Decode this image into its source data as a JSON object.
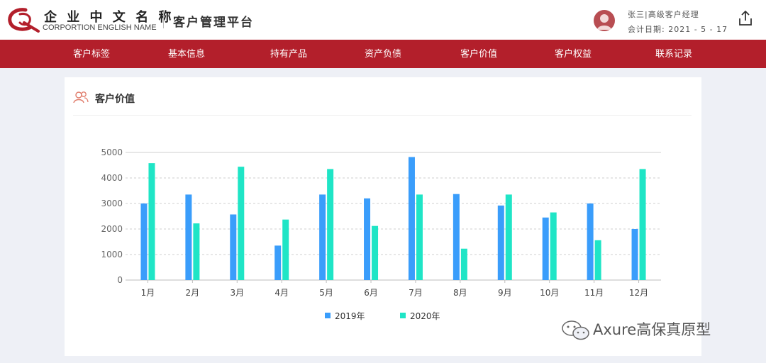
{
  "header": {
    "logo_cn": "企 业 中 文 名 称",
    "logo_en": "CORPORTION ENGLISH NAME",
    "platform_title": "客户管理平台",
    "user": "张三|高级客户经理",
    "date": "会计日期: 2021 - 5 - 17",
    "icons": {
      "avatar": "user-avatar-icon",
      "export": "export-icon"
    },
    "colors": {
      "brand_red": "#b31f2b",
      "avatar": "#b84d52"
    }
  },
  "nav": {
    "items": [
      "客户标签",
      "基本信息",
      "持有产品",
      "资产负债",
      "客户价值",
      "客户权益",
      "联系记录"
    ]
  },
  "card": {
    "title": "客户价值",
    "icon": "users-icon"
  },
  "chart_data": {
    "type": "bar",
    "categories": [
      "1月",
      "2月",
      "3月",
      "4月",
      "5月",
      "6月",
      "7月",
      "8月",
      "9月",
      "10月",
      "11月",
      "12月"
    ],
    "series": [
      {
        "name": "2019年",
        "color": "#3a9dfb",
        "values": [
          3000,
          3350,
          2570,
          1350,
          3350,
          3200,
          4820,
          3370,
          2920,
          2450,
          3000,
          2000
        ]
      },
      {
        "name": "2020年",
        "color": "#1fe5c6",
        "values": [
          4580,
          2220,
          4440,
          2370,
          4350,
          2120,
          3350,
          1230,
          3350,
          2650,
          1560,
          4350
        ]
      }
    ],
    "yticks": [
      0,
      1000,
      2000,
      3000,
      4000,
      5000
    ],
    "ylim": [
      0,
      5000
    ],
    "grid": true,
    "legend_position": "bottom-center",
    "xlabel": "",
    "ylabel": ""
  },
  "watermark": {
    "text": "Axure高保真原型",
    "icon": "wechat-icon"
  }
}
